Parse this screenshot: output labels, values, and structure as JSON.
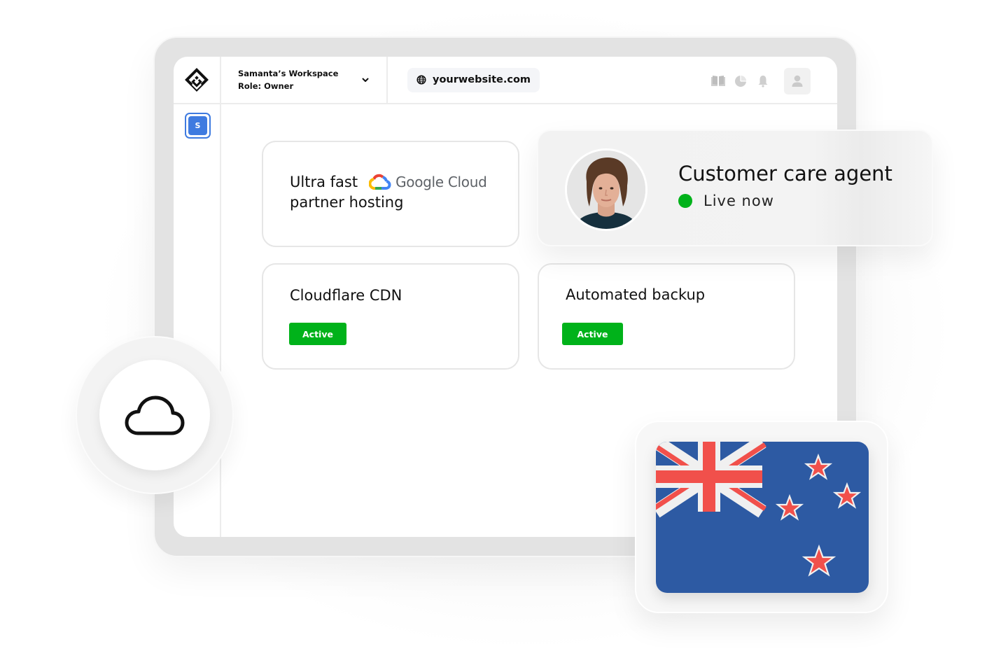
{
  "header": {
    "workspace_name": "Samanta’s Workspace",
    "workspace_role": "Role: Owner",
    "url": "yourwebsite.com",
    "icons": [
      "book-icon",
      "pie-chart-icon",
      "bell-icon",
      "user-icon"
    ]
  },
  "sidebar": {
    "items": [
      {
        "label": "S",
        "active": true,
        "color": "#3f7be0"
      }
    ]
  },
  "cards": {
    "hosting": {
      "line1": "Ultra fast",
      "brand": "Google Cloud",
      "line2": "partner hosting"
    },
    "cdn": {
      "title": "Cloudflare CDN",
      "status": "Active"
    },
    "backup": {
      "title": "Automated backup",
      "status": "Active"
    }
  },
  "agent": {
    "title": "Customer care agent",
    "status": "Live now",
    "status_color": "#00b21a"
  },
  "badges": {
    "active_color": "#00b21a"
  },
  "flag": {
    "country": "New Zealand",
    "colors": {
      "blue": "#2d5aa3",
      "red": "#f1504b",
      "white": "#f0f0f0"
    }
  },
  "cloud_badge": {
    "icon": "cloud-icon"
  }
}
